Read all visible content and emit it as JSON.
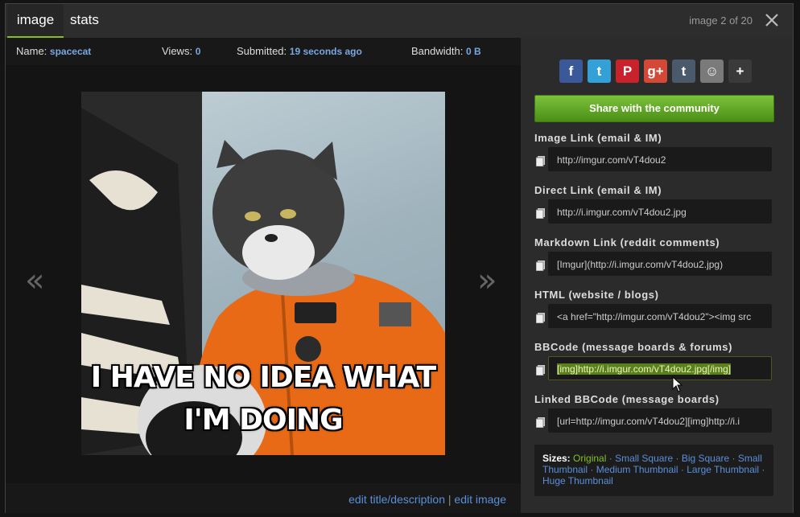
{
  "header": {
    "tabs": [
      {
        "label": "image"
      },
      {
        "label": "stats"
      }
    ],
    "counter": "image 2 of 20"
  },
  "info": {
    "name_label": "Name:",
    "name_value": "spacecat",
    "views_label": "Views:",
    "views_value": "0",
    "submitted_label": "Submitted:",
    "submitted_value": "19 seconds ago",
    "bandwidth_label": "Bandwidth:",
    "bandwidth_value": "0 B"
  },
  "viewer": {
    "prev": "«",
    "next": "»",
    "caption_line1": "I HAVE NO IDEA WHAT",
    "caption_line2": "I'M DOING"
  },
  "bottom": {
    "edit_title": "edit title/description",
    "separator": "|",
    "edit_image": "edit image"
  },
  "social": [
    {
      "icon": "facebook-icon",
      "glyph": "f",
      "color": "#3b5998"
    },
    {
      "icon": "twitter-icon",
      "glyph": "t",
      "color": "#33a0d8"
    },
    {
      "icon": "pinterest-icon",
      "glyph": "P",
      "color": "#c8232c"
    },
    {
      "icon": "google-plus-icon",
      "glyph": "g+",
      "color": "#d34836"
    },
    {
      "icon": "tumblr-icon",
      "glyph": "t",
      "color": "#4a5a6a"
    },
    {
      "icon": "reddit-icon",
      "glyph": "☺",
      "color": "#7a7a7a"
    },
    {
      "icon": "more-icon",
      "glyph": "+",
      "color": "#3a3a3a"
    }
  ],
  "share": {
    "label": "Share with the community"
  },
  "links": [
    {
      "label": "Image Link (email & IM)",
      "value": "http://imgur.com/vT4dou2"
    },
    {
      "label": "Direct Link (email & IM)",
      "value": "http://i.imgur.com/vT4dou2.jpg"
    },
    {
      "label": "Markdown Link (reddit comments)",
      "value": "[Imgur](http://i.imgur.com/vT4dou2.jpg)"
    },
    {
      "label": "HTML (website / blogs)",
      "value": "<a href=\"http://imgur.com/vT4dou2\"><img src"
    },
    {
      "label": "BBCode (message boards & forums)",
      "value": "[img]http://i.imgur.com/vT4dou2.jpg[/img]"
    },
    {
      "label": "Linked BBCode (message boards)",
      "value": "[url=http://imgur.com/vT4dou2][img]http://i.i"
    }
  ],
  "sizes": {
    "label": "Sizes:",
    "options": [
      "Original",
      "Small Square",
      "Big Square",
      "Small Thumbnail",
      "Medium Thumbnail",
      "Large Thumbnail",
      "Huge Thumbnail"
    ],
    "separator": "·"
  },
  "colors": {
    "accent": "#85bf25",
    "link": "#5b8fd9"
  }
}
